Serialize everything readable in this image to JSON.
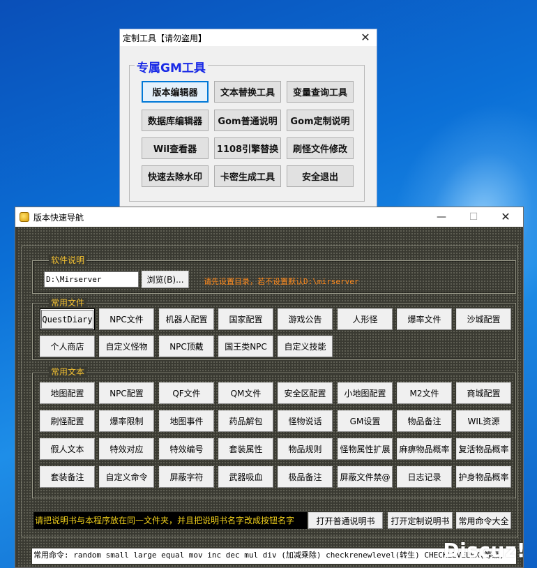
{
  "win1": {
    "title": "定制工具【请勿盗用】",
    "group_title": "专属GM工具",
    "buttons": [
      "版本编辑器",
      "文本替换工具",
      "变量查询工具",
      "数据库编辑器",
      "Gom普通说明",
      "Gom定制说明",
      "Wil查看器",
      "1108引擎替换",
      "刷怪文件修改",
      "快速去除水印",
      "卡密生成工具",
      "安全退出"
    ]
  },
  "win2": {
    "title": "版本快速导航",
    "software": {
      "label": "软件说明",
      "path_value": "D:\\Mirserver",
      "browse_label": "浏览(B)...",
      "hint": "请先设置目录，若不设置默认D:\\mirserver"
    },
    "files": {
      "label": "常用文件",
      "buttons": [
        "QuestDiary",
        "NPC文件",
        "机器人配置",
        "国家配置",
        "游戏公告",
        "人形怪",
        "爆率文件",
        "沙城配置",
        "个人商店",
        "自定义怪物",
        "NPC顶戴",
        "国王类NPC",
        "自定义技能"
      ]
    },
    "texts": {
      "label": "常用文本",
      "buttons": [
        "地图配置",
        "NPC配置",
        "QF文件",
        "QM文件",
        "安全区配置",
        "小地图配置",
        "M2文件",
        "商城配置",
        "刷怪配置",
        "爆率限制",
        "地图事件",
        "药品解包",
        "怪物说话",
        "GM设置",
        "物品备注",
        "WIL资源",
        "假人文本",
        "特效对应",
        "特效编号",
        "套装属性",
        "物品规则",
        "怪物属性扩展",
        "麻痹物品概率",
        "复活物品概率",
        "套装备注",
        "自定义命令",
        "屏蔽字符",
        "武器吸血",
        "极品备注",
        "屏蔽文件禁@",
        "日志记录",
        "护身物品概率"
      ]
    },
    "notice": "请把说明书与本程序放在同一文件夹，并且把说明书名字改成按钮名字",
    "manual_buttons": [
      "打开普通说明书",
      "打开定制说明书",
      "常用命令大全"
    ],
    "commands": "常用命令: random small large equal mov inc dec mul div (加减乘除) checkrenewlevel(转生)  CHECKLEVELEX(等级)"
  },
  "watermark": "Discuz!"
}
